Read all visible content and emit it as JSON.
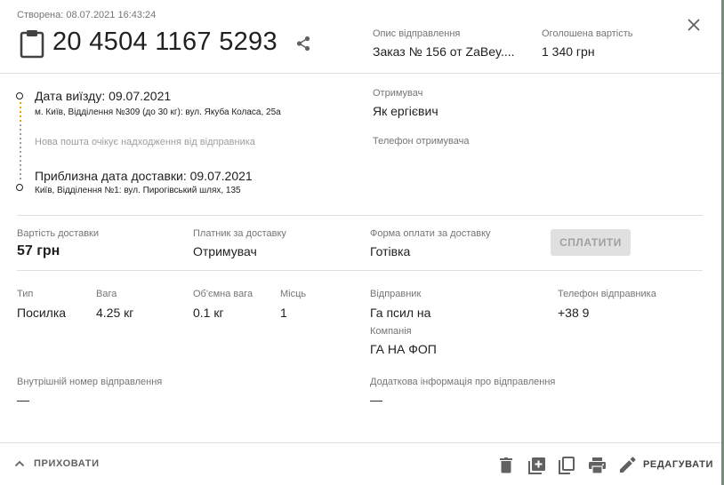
{
  "header": {
    "created": "Створена: 08.07.2021 16:43:24",
    "tracking_number": "20 4504 1167 5293",
    "description_label": "Опис відправлення",
    "description_value": "Заказ № 156 от ZaBey....",
    "declared_label": "Оголошена вартість",
    "declared_value": "1 340 грн"
  },
  "route": {
    "departure_title": "Дата виїзду: 09.07.2021",
    "departure_address": "м. Київ, Відділення №309 (до 30 кг): вул. Якуба Коласа, 25а",
    "status_note": "Нова пошта очікує надходження від відправника",
    "arrival_title": "Приблизна дата доставки: 09.07.2021",
    "arrival_address": "Київ, Відділення №1: вул. Пирогівський шлях, 135"
  },
  "recipient": {
    "label": "Отримувач",
    "value": "Як              ергієвич",
    "phone_label": "Телефон отримувача",
    "phone_value": ""
  },
  "payment": {
    "cost_label": "Вартість доставки",
    "cost_value": "57 грн",
    "payer_label": "Платник за доставку",
    "payer_value": "Отримувач",
    "method_label": "Форма оплати за доставку",
    "method_value": "Готівка",
    "pay_button": "СПЛАТИТИ"
  },
  "parcel": {
    "type_label": "Тип",
    "type_value": "Посилка",
    "weight_label": "Вага",
    "weight_value": "4.25 кг",
    "volume_label": "Об'ємна вага",
    "volume_value": "0.1 кг",
    "places_label": "Місць",
    "places_value": "1"
  },
  "sender": {
    "label": "Відправник",
    "value": "Га              псил на",
    "phone_label": "Телефон відправника",
    "phone_value": "+38              9",
    "company_label": "Компанія",
    "company_value": "ГА              НА ФОП"
  },
  "extra": {
    "internal_label": "Внутрішній номер відправлення",
    "internal_value": "—",
    "info_label": "Додаткова інформація про відправлення",
    "info_value": "—"
  },
  "footer": {
    "hide_label": "ПРИХОВАТИ",
    "edit_label": "РЕДАГУВАТИ"
  },
  "icons": [
    "clipboard-icon",
    "share-icon",
    "close-icon",
    "chevron-up-icon",
    "delete-icon",
    "add-copy-icon",
    "copy-icon",
    "print-icon",
    "edit-icon"
  ],
  "colors": {
    "accent_dash": "#f0a500",
    "divider": "#e0e0e0",
    "caption": "#757575"
  }
}
